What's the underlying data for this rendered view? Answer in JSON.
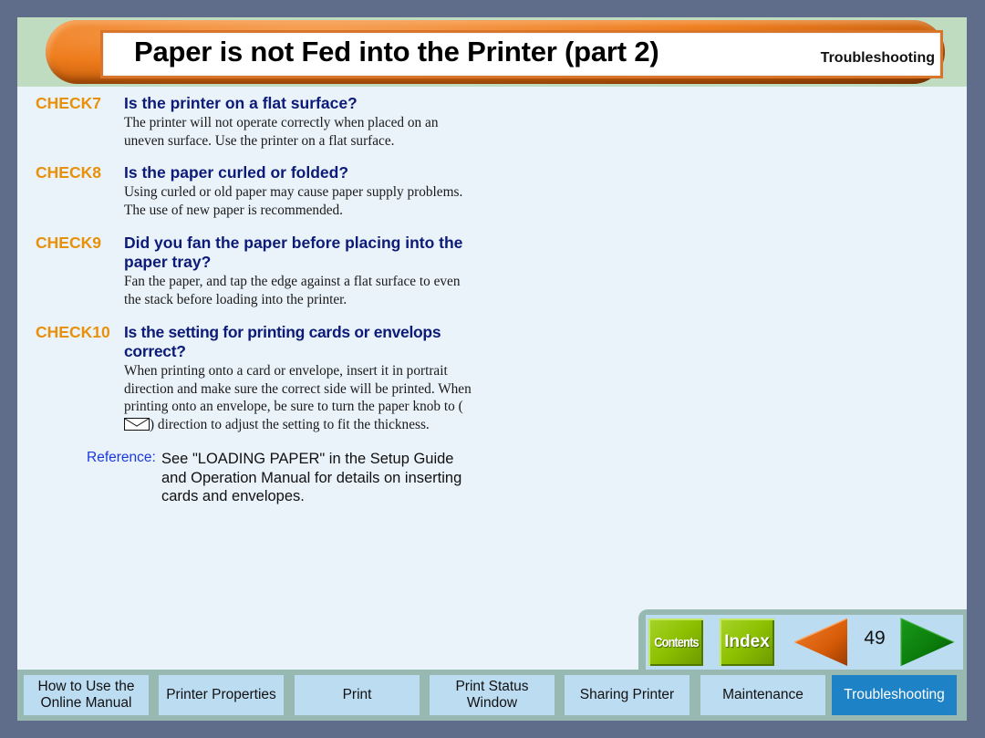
{
  "header": {
    "title": "Paper is not Fed into the Printer (part 2)",
    "section": "Troubleshooting"
  },
  "checks": [
    {
      "label": "CHECK7",
      "question": "Is the printer on a flat surface?",
      "body": "The printer will not operate correctly when placed on an uneven surface. Use the printer on a flat surface."
    },
    {
      "label": "CHECK8",
      "question": "Is the paper curled or folded?",
      "body": "Using curled or old paper may cause paper supply problems. The use of new paper is recommended."
    },
    {
      "label": "CHECK9",
      "question": "Did you fan the paper before placing into the paper tray?",
      "body": "Fan the paper, and tap the edge against a flat surface to even the stack before loading into the printer."
    },
    {
      "label": "CHECK10",
      "question": "Is the setting for printing cards or envelops correct?",
      "body_before_icon": "When printing onto a card or envelope, insert it in portrait direction and make sure the correct side will be printed. When printing onto an envelope, be sure to turn the paper knob to (",
      "body_icon": "envelope-icon",
      "body_after_icon": ") direction to adjust the setting to fit the thickness."
    }
  ],
  "reference": {
    "label": "Reference:",
    "text": "See \"LOADING PAPER\" in the Setup Guide and Operation Manual for details on inserting cards and envelopes."
  },
  "navigation": {
    "contents_label": "Contents",
    "index_label": "Index",
    "prev_icon": "left-arrow-icon",
    "next_icon": "right-arrow-icon",
    "page_number": "49",
    "colors": {
      "green_button": "#8cc000",
      "prev_arrow": "#e06010",
      "next_arrow": "#0a7a0a"
    }
  },
  "tabs": [
    {
      "label": "How to Use the Online Manual",
      "active": false
    },
    {
      "label": "Printer Properties",
      "active": false
    },
    {
      "label": "Print",
      "active": false
    },
    {
      "label": "Print Status Window",
      "active": false
    },
    {
      "label": "Sharing Printer",
      "active": false
    },
    {
      "label": "Maintenance",
      "active": false
    },
    {
      "label": "Troubleshooting",
      "active": true
    }
  ],
  "colors": {
    "background": "#5f6d8a",
    "content": "#eaf3fa",
    "header_band": "#c0dcc0",
    "check_label": "#e8900a",
    "check_question": "#0c1a78",
    "reference_label": "#1a38e0",
    "tab": "#bcdcf2",
    "tab_active": "#1e82c6"
  }
}
